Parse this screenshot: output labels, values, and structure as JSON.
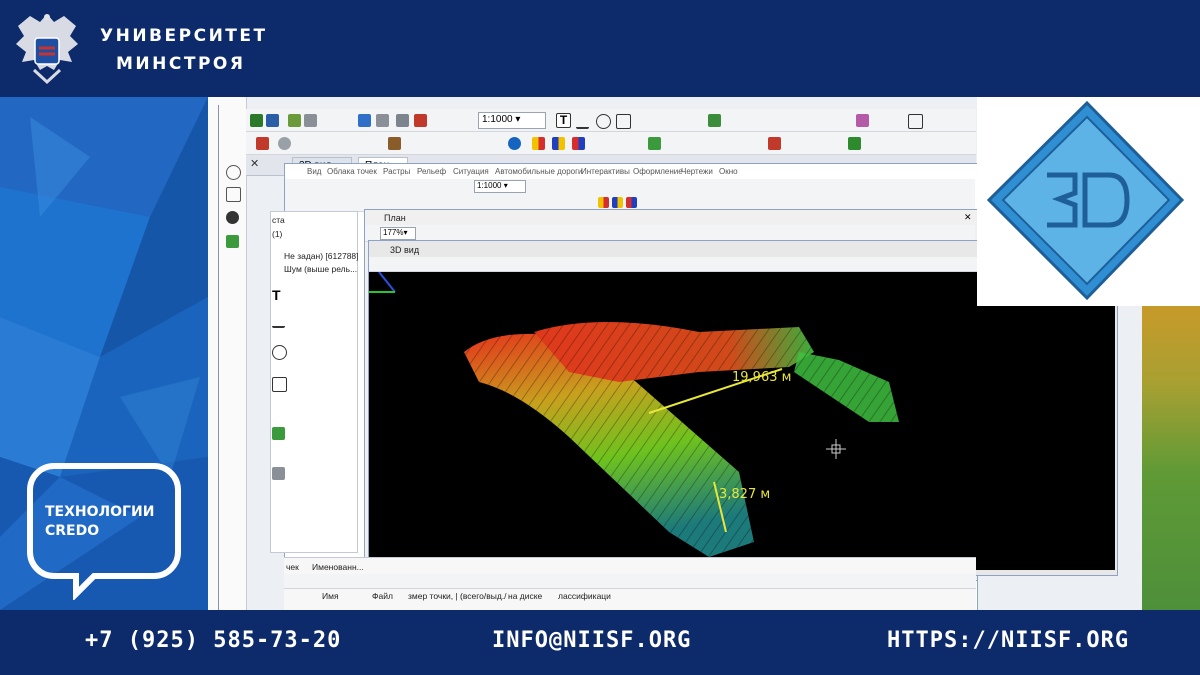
{
  "header": {
    "org_line1": "УНИВЕРСИТЕТ",
    "org_line2": "МИНСТРОЯ",
    "emblem_icon": "double-headed-eagle-emblem-icon"
  },
  "brand": {
    "credo_line1": "ТЕХНОЛОГИИ",
    "credo_line2": "CREDO",
    "logo_3d_icon": "3d-diamond-logo-icon"
  },
  "app": {
    "scale_main": "1:1000",
    "scale_inner": "1:1000",
    "zoom": "177%",
    "window_3d_tab_back": "3D вид",
    "window_plan_tab": "План",
    "menu": [
      "Вид",
      "Облака точек",
      "Растры",
      "Рельеф",
      "Ситуация",
      "Автомобильные дороги",
      "Интерактивы",
      "Оформление",
      "Чертежи",
      "Окно"
    ],
    "plan_title": "План",
    "view3d_title": "3D вид",
    "layers": {
      "line0": "ста",
      "line1": "(1)",
      "line2": "Не задан) [612788]",
      "line3": "Шум (выше рель..."
    },
    "bottom_tabs": {
      "tab1": "чек",
      "tab2": "Именованн..."
    },
    "table_headers": [
      "Имя",
      "Файл",
      "змер точки, | :",
      "(всего/выд./",
      "на диске",
      "лассификаци"
    ],
    "measurements": {
      "long": "19,963  м",
      "short": "3,827  м"
    }
  },
  "footer": {
    "phone": "+7 (925) 585-73-20",
    "email": "INFO@NIISF.ORG",
    "site": "HTTPS://NIISF.ORG"
  },
  "colors": {
    "navy": "#0d2b6b",
    "accent_blue": "#1565c0",
    "measure_yellow": "#e9e63a"
  }
}
